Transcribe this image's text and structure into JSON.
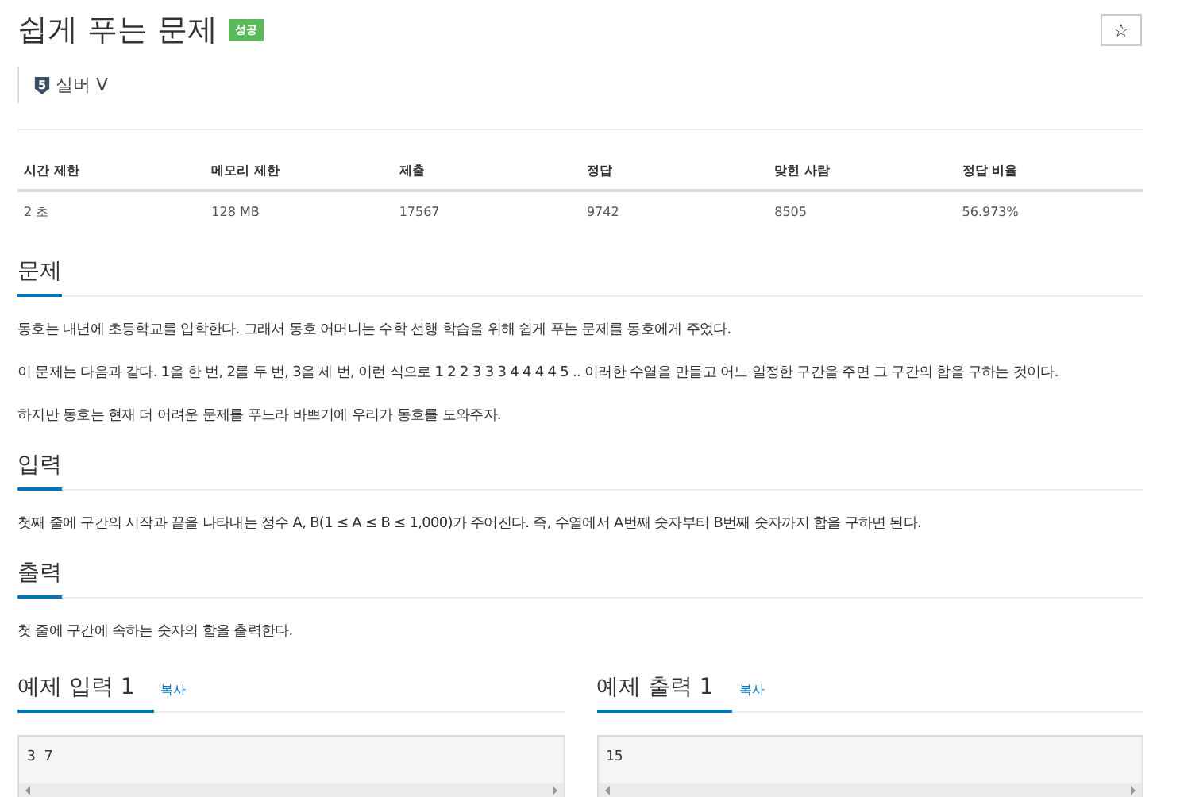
{
  "title": "쉽게 푸는 문제",
  "result_badge": "성공",
  "star_button": "☆",
  "tier": {
    "number": "5",
    "label": "실버 V"
  },
  "stats": {
    "columns": [
      "시간 제한",
      "메모리 제한",
      "제출",
      "정답",
      "맞힌 사람",
      "정답 비율"
    ],
    "values": [
      "2 초",
      "128 MB",
      "17567",
      "9742",
      "8505",
      "56.973%"
    ]
  },
  "sections": [
    {
      "heading": "문제",
      "paragraphs": [
        "동호는 내년에 초등학교를 입학한다. 그래서 동호 어머니는 수학 선행 학습을 위해 쉽게 푸는 문제를 동호에게 주었다.",
        "이 문제는 다음과 같다. 1을 한 번, 2를 두 번, 3을 세 번, 이런 식으로 1 2 2 3 3 3 4 4 4 4 5 .. 이러한 수열을 만들고 어느 일정한 구간을 주면 그 구간의 합을 구하는 것이다.",
        "하지만 동호는 현재 더 어려운 문제를 푸느라 바쁘기에 우리가 동호를 도와주자."
      ]
    },
    {
      "heading": "입력",
      "paragraphs": [
        "첫째 줄에 구간의 시작과 끝을 나타내는 정수 A, B(1 ≤ A ≤ B ≤ 1,000)가 주어진다. 즉, 수열에서 A번째 숫자부터 B번째 숫자까지 합을 구하면 된다."
      ]
    },
    {
      "heading": "출력",
      "paragraphs": [
        "첫 줄에 구간에 속하는 숫자의 합을 출력한다."
      ]
    }
  ],
  "examples": [
    {
      "heading": "예제 입력 1",
      "copy": "복사",
      "content": "3 7"
    },
    {
      "heading": "예제 출력 1",
      "copy": "복사",
      "content": "15"
    }
  ]
}
